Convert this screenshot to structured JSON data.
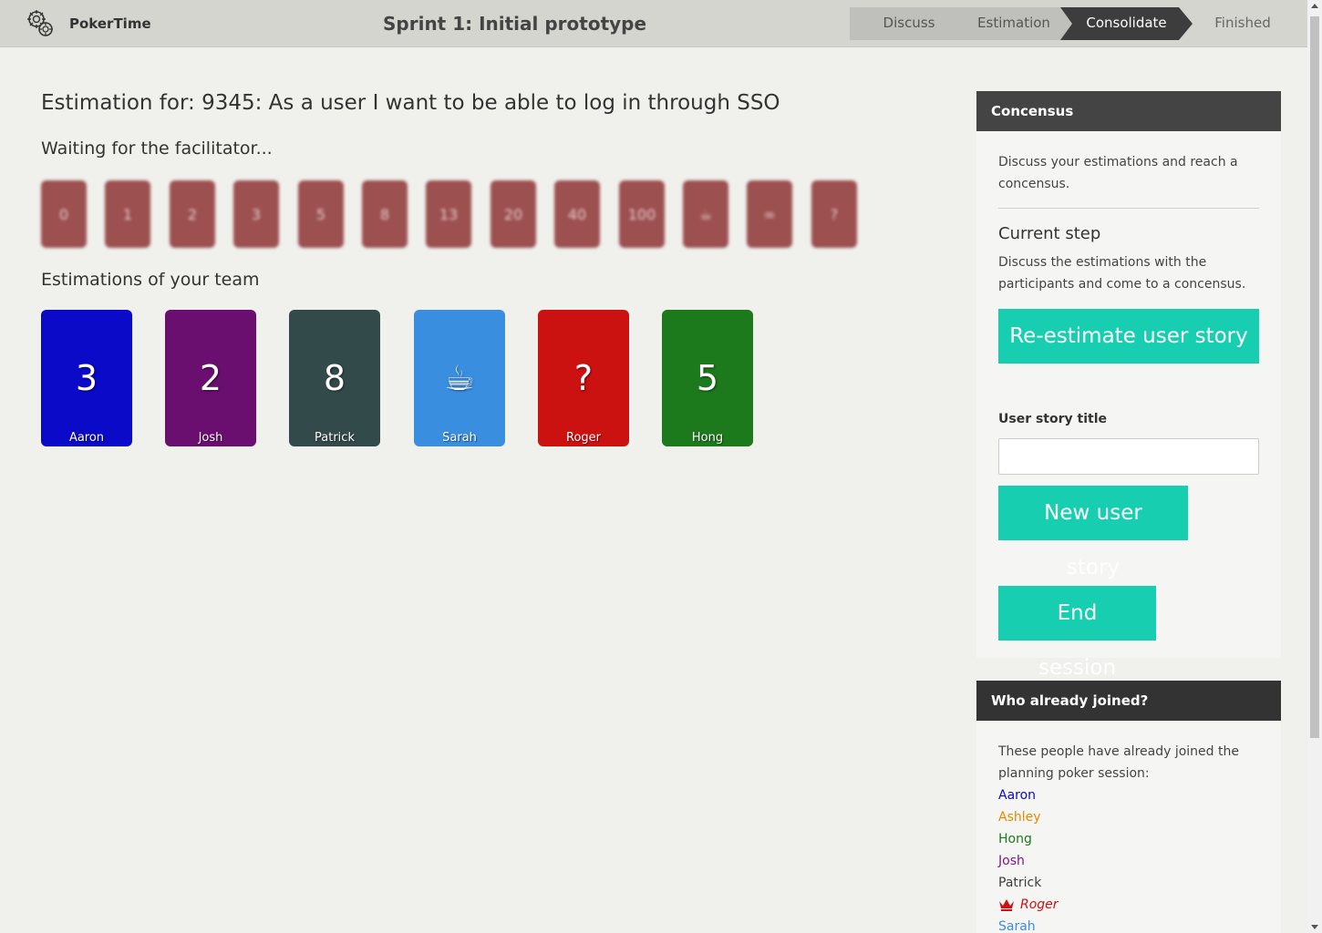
{
  "app": {
    "name": "PokerTime",
    "logo_icon": "poker-chip-gear-icon"
  },
  "session": {
    "title": "Sprint 1: Initial prototype"
  },
  "steps": [
    {
      "label": "Discuss",
      "state": "done"
    },
    {
      "label": "Estimation",
      "state": "done"
    },
    {
      "label": "Consolidate",
      "state": "active"
    },
    {
      "label": "Finished",
      "state": "pending"
    }
  ],
  "main": {
    "estimation_title": "Estimation for: 9345: As a user I want to be able to log in through SSO",
    "waiting_text": "Waiting for the facilitator...",
    "deck": [
      "0",
      "1",
      "2",
      "3",
      "5",
      "8",
      "13",
      "20",
      "40",
      "100",
      "☕",
      "∞",
      "?"
    ],
    "team_title": "Estimations of your team",
    "team": [
      {
        "name": "Aaron",
        "value": "3",
        "color": "#0a0ac8"
      },
      {
        "name": "Josh",
        "value": "2",
        "color": "#6a0f6f"
      },
      {
        "name": "Patrick",
        "value": "8",
        "color": "#334a4a"
      },
      {
        "name": "Sarah",
        "value": "☕",
        "color": "#3a8ee0"
      },
      {
        "name": "Roger",
        "value": "?",
        "color": "#cc1111"
      },
      {
        "name": "Hong",
        "value": "5",
        "color": "#1c7a1c"
      }
    ]
  },
  "consensus_panel": {
    "title": "Concensus",
    "description": "Discuss your estimations and reach a concensus.",
    "current_step_heading": "Current step",
    "current_step_text": "Discuss the estimations with the participants and come to a concensus.",
    "reestimate_label": "Re-estimate user story",
    "story_title_label": "User story title",
    "story_title_value": "",
    "new_story_label": "New user story",
    "end_session_label": "End session",
    "button_color": "#17cfb0"
  },
  "joined_panel": {
    "title": "Who already joined?",
    "description": "These people have already joined the planning poker session:",
    "people": [
      {
        "name": "Aaron",
        "color": "#0a0ac8",
        "facilitator": false
      },
      {
        "name": "Ashley",
        "color": "#e58a00",
        "facilitator": false
      },
      {
        "name": "Hong",
        "color": "#1c7a1c",
        "facilitator": false
      },
      {
        "name": "Josh",
        "color": "#7a1a8a",
        "facilitator": false
      },
      {
        "name": "Patrick",
        "color": "#3d3d3d",
        "facilitator": false
      },
      {
        "name": "Roger",
        "color": "#cc1111",
        "facilitator": true
      },
      {
        "name": "Sarah",
        "color": "#3a8ee0",
        "facilitator": false
      }
    ]
  }
}
